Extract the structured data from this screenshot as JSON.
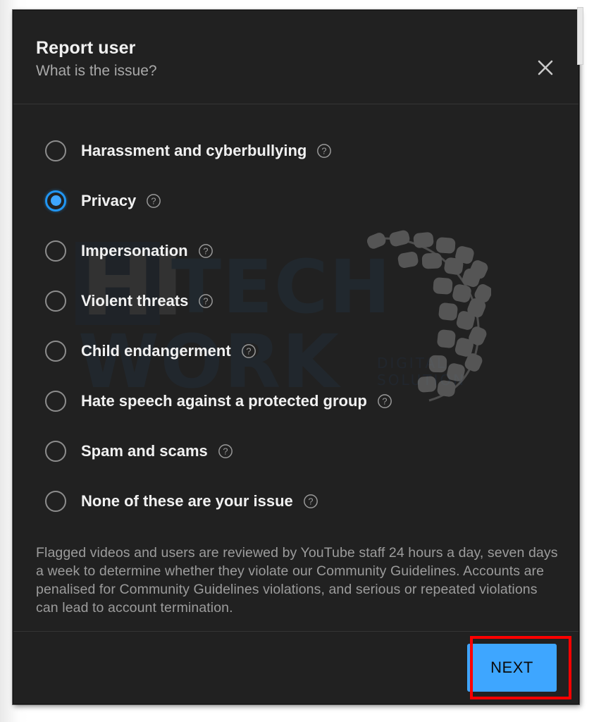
{
  "dialog": {
    "title": "Report user",
    "subtitle": "What is the issue?",
    "close_label": "Close"
  },
  "options": [
    {
      "label": "Harassment and cyberbullying",
      "selected": false,
      "help": "help-icon"
    },
    {
      "label": "Privacy",
      "selected": true,
      "help": "help-icon"
    },
    {
      "label": "Impersonation",
      "selected": false,
      "help": "help-icon"
    },
    {
      "label": "Violent threats",
      "selected": false,
      "help": "help-icon"
    },
    {
      "label": "Child endangerment",
      "selected": false,
      "help": "help-icon"
    },
    {
      "label": "Hate speech against a protected group",
      "selected": false,
      "help": "help-icon"
    },
    {
      "label": "Spam and scams",
      "selected": false,
      "help": "help-icon"
    },
    {
      "label": "None of these are your issue",
      "selected": false,
      "help": "help-icon"
    }
  ],
  "disclaimer": "Flagged videos and users are reviewed by YouTube staff 24 hours a day, seven days a week to determine whether they violate our Community Guidelines. Accounts are penalised for Community Guidelines violations, and serious or repeated violations can lead to account termination.",
  "footer": {
    "next_label": "NEXT"
  },
  "watermark": {
    "hi": "HI",
    "tech": "TECH",
    "work": "WORK",
    "tagline": "DIGITAL SOLUTION"
  },
  "colors": {
    "dialog_background": "#212121",
    "accent_blue": "#3ea6ff",
    "radio_selected": "#2196f3",
    "primary_text": "#f1f1f1",
    "secondary_text": "#9c9c9c",
    "annotation_red": "#ff0000",
    "divider": "#343434"
  }
}
